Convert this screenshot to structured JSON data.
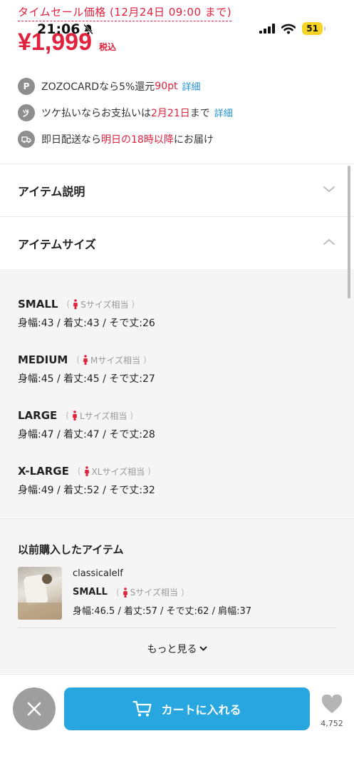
{
  "status": {
    "time": "21:06",
    "battery": "51"
  },
  "timesale": {
    "label": "タイムセール価格 (12月24日 09:00 まで)"
  },
  "price": {
    "amount": "¥1,999",
    "tax": "税込"
  },
  "info": {
    "zozocard": {
      "icon": "P",
      "pre": "ZOZOCARDなら5%還元 ",
      "points": "90pt",
      "link": "詳細"
    },
    "tsuke": {
      "pre": "ツケ払いならお支払いは",
      "date": "2月21日",
      "post": "まで",
      "link": "詳細"
    },
    "delivery": {
      "pre": "即日配送なら",
      "time": "明日の18時以降",
      "post": "にお届け"
    }
  },
  "accordions": {
    "description": "アイテム説明",
    "size": "アイテムサイズ"
  },
  "sizes": [
    {
      "name": "SMALL",
      "equiv": "Sサイズ相当",
      "measure": "身幅:43 / 着丈:43 / そで丈:26"
    },
    {
      "name": "MEDIUM",
      "equiv": "Mサイズ相当",
      "measure": "身幅:45 / 着丈:45 / そで丈:27"
    },
    {
      "name": "LARGE",
      "equiv": "Lサイズ相当",
      "measure": "身幅:47 / 着丈:47 / そで丈:28"
    },
    {
      "name": "X-LARGE",
      "equiv": "XLサイズ相当",
      "measure": "身幅:49 / 着丈:52 / そで丈:32"
    }
  ],
  "previous": {
    "title": "以前購入したアイテム",
    "shop": "classicalelf",
    "size": "SMALL",
    "equiv": "Sサイズ相当",
    "measure": "身幅:46.5 / 着丈:57 / そで丈:62 / 肩幅:37",
    "more": "もっと見る"
  },
  "bottom": {
    "cart": "カートに入れる",
    "favorites": "4,752"
  },
  "colors": {
    "accent_red": "#e0223f",
    "accent_blue": "#27a6df",
    "link_blue": "#1f8fd1"
  }
}
